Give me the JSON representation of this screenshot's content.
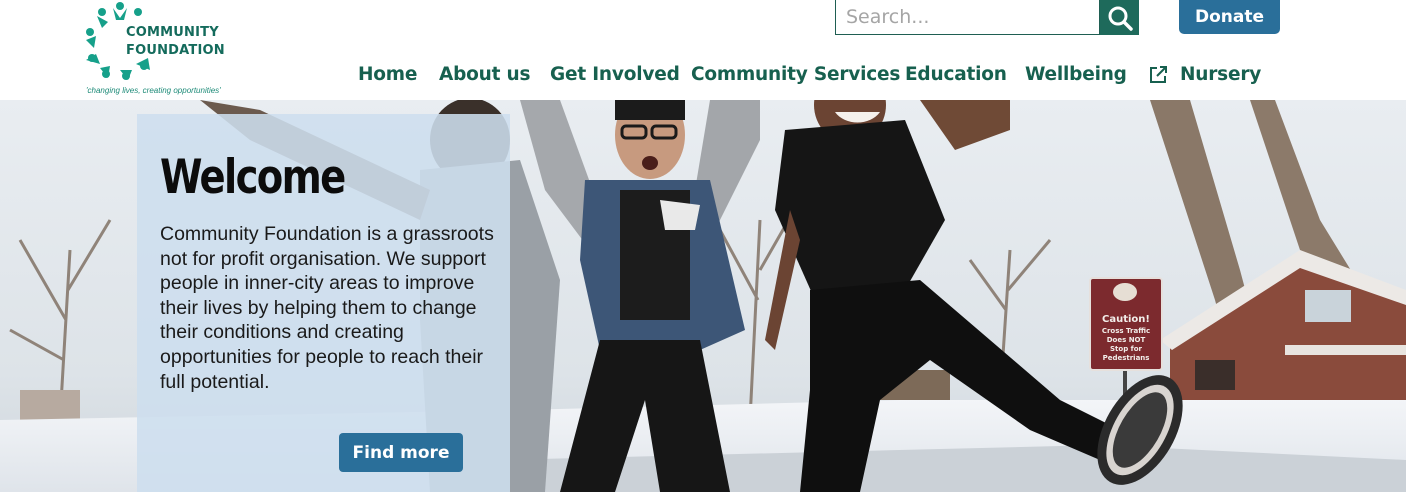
{
  "logo": {
    "line1": "COMMUNITY",
    "line2": "FOUNDATION",
    "tagline": "'changing lives, creating opportunities'"
  },
  "search": {
    "placeholder": "Search..."
  },
  "donate": {
    "label": "Donate"
  },
  "nav": {
    "items": [
      {
        "label": "Home"
      },
      {
        "label": "About us"
      },
      {
        "label": "Get Involved"
      },
      {
        "label": "Community Services"
      },
      {
        "label": "Education"
      },
      {
        "label": "Wellbeing"
      },
      {
        "label": "Nursery",
        "icon": "external-link-icon"
      }
    ]
  },
  "hero": {
    "title": "Welcome",
    "body": "Community Foundation is a grassroots not for profit organisation. We support people in inner-city areas to improve their lives by helping them to change their conditions and creating opportunities for people to reach their full potential.",
    "button": "Find more",
    "sign": {
      "line1": "Caution!",
      "line2": "Cross Traffic",
      "line3": "Does NOT",
      "line4": "Stop for",
      "line5": "Pedestrians"
    }
  },
  "colors": {
    "brand_green": "#17604f",
    "button_blue": "#2a6f9a",
    "card": "#cddeee"
  }
}
